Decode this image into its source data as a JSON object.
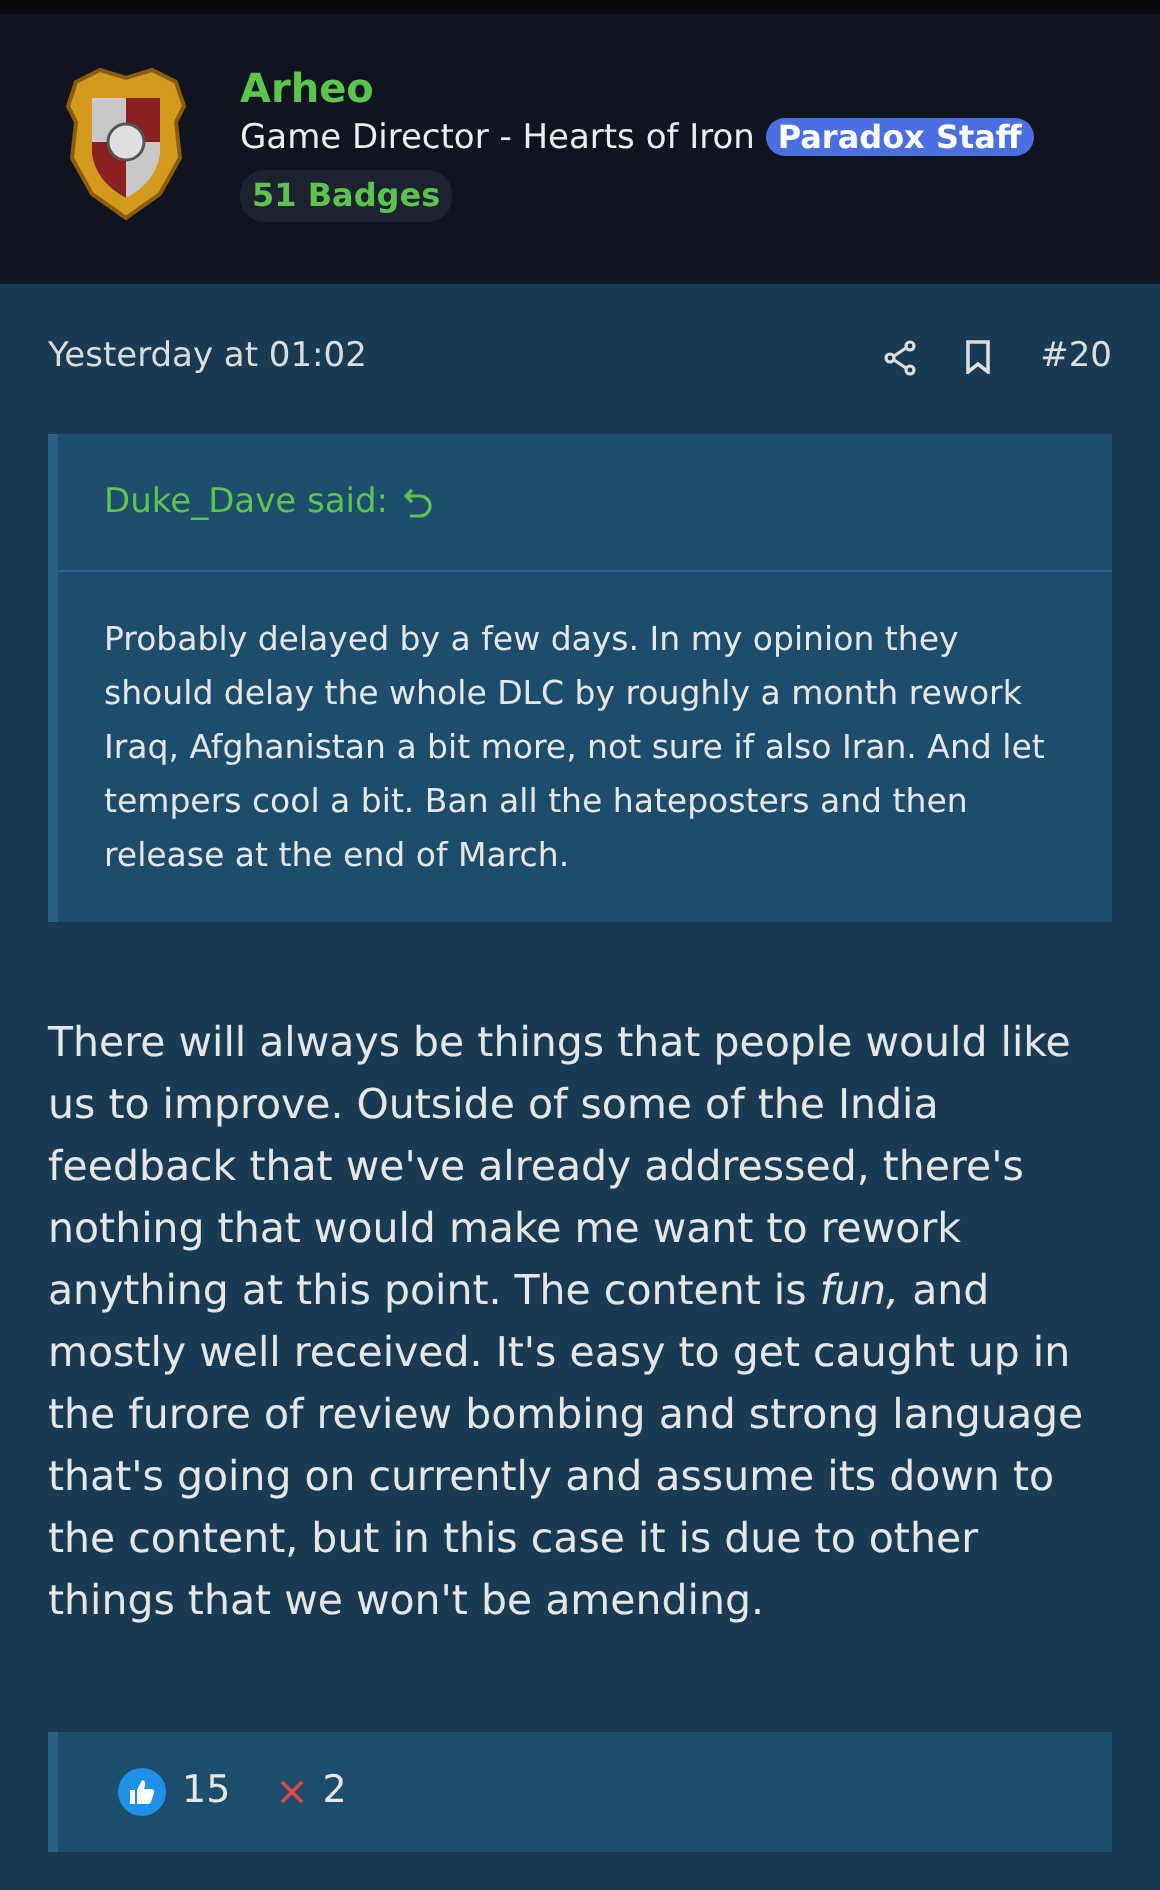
{
  "author": {
    "name": "Arheo",
    "title": "Game Director - Hearts of Iron",
    "staff_badge": "Paradox Staff",
    "badges": "51 Badges"
  },
  "post": {
    "date": "Yesterday at 01:02",
    "number": "#20",
    "quote": {
      "author": "Duke_Dave said:",
      "text": "Probably delayed by a few days. In my opinion they should delay the whole DLC by roughly a month rework Iraq, Afghanistan a bit more, not sure if also Iran. And let tempers cool a bit. Ban all the hateposters and then release at the end of March."
    },
    "body": "There will always be things that people would like us to improve. Outside of some of the India feedback that we've already addressed, there's nothing that would make me want to rework anything at this point. The content is *fun,* and mostly well received. It's easy to get caught up in the furore of review bombing and strong language that's going on currently and assume its down to the content, but in this case it is due to other things that we won't be amending.",
    "reactions": [
      {
        "kind": "like",
        "count": "15"
      },
      {
        "kind": "dislike",
        "count": "2"
      }
    ]
  }
}
